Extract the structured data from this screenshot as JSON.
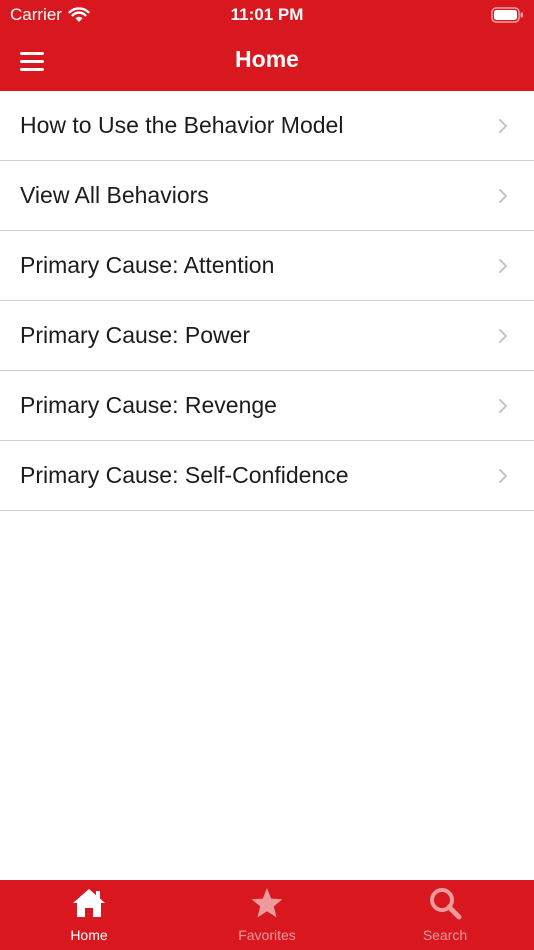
{
  "status_bar": {
    "carrier": "Carrier",
    "time": "11:01 PM"
  },
  "nav": {
    "title": "Home"
  },
  "list": {
    "items": [
      {
        "label": "How to Use the Behavior Model"
      },
      {
        "label": "View All Behaviors"
      },
      {
        "label": "Primary Cause: Attention"
      },
      {
        "label": "Primary Cause: Power"
      },
      {
        "label": "Primary Cause: Revenge"
      },
      {
        "label": "Primary Cause: Self-Confidence"
      }
    ]
  },
  "tab_bar": {
    "tabs": [
      {
        "label": "Home",
        "icon": "home-icon",
        "active": true
      },
      {
        "label": "Favorites",
        "icon": "star-icon",
        "active": false
      },
      {
        "label": "Search",
        "icon": "search-icon",
        "active": false
      }
    ]
  },
  "colors": {
    "accent": "#d8171e",
    "inactive_tab": "#ee9a9d",
    "separator": "#cfcfd4",
    "chevron": "#c4c4c9"
  }
}
